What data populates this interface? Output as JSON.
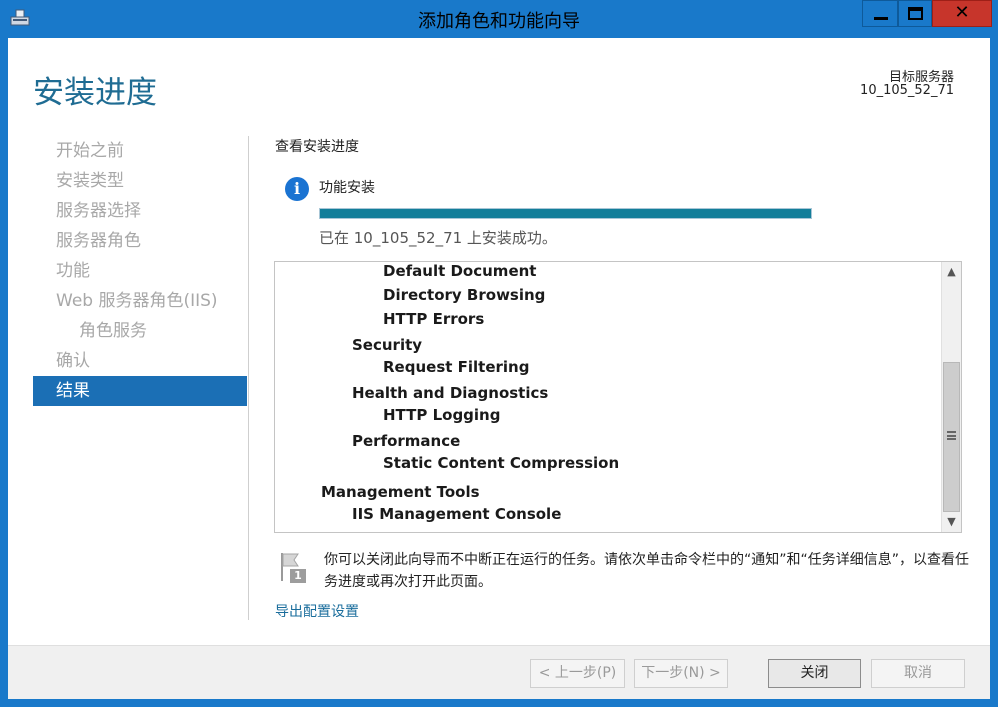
{
  "window": {
    "title": "添加角色和功能向导"
  },
  "header": {
    "page_title": "安装进度",
    "target_label": "目标服务器",
    "target_name": "10_105_52_71"
  },
  "nav": {
    "items": [
      {
        "label": "开始之前"
      },
      {
        "label": "安装类型"
      },
      {
        "label": "服务器选择"
      },
      {
        "label": "服务器角色"
      },
      {
        "label": "功能"
      },
      {
        "label": "Web 服务器角色(IIS)"
      },
      {
        "label": "角色服务"
      },
      {
        "label": "确认"
      },
      {
        "label": "结果"
      }
    ],
    "active_index": 8
  },
  "main": {
    "section_heading": "查看安装进度",
    "feature_label": "功能安装",
    "progress_percent": 100,
    "status_text": "已在 10_105_52_71 上安装成功。",
    "results": [
      {
        "label": "Default Document",
        "level": 3
      },
      {
        "label": "Directory Browsing",
        "level": 3
      },
      {
        "label": "HTTP Errors",
        "level": 3
      },
      {
        "label": "Security",
        "level": 2
      },
      {
        "label": "Request Filtering",
        "level": 3
      },
      {
        "label": "Health and Diagnostics",
        "level": 2
      },
      {
        "label": "HTTP Logging",
        "level": 3
      },
      {
        "label": "Performance",
        "level": 2
      },
      {
        "label": "Static Content Compression",
        "level": 3
      },
      {
        "label": "Management Tools",
        "level": 1
      },
      {
        "label": "IIS Management Console",
        "level": 2
      }
    ],
    "notice_badge": "1",
    "notice_text": "你可以关闭此向导而不中断正在运行的任务。请依次单击命令栏中的“通知”和“任务详细信息”，以查看任务进度或再次打开此页面。",
    "export_link": "导出配置设置"
  },
  "footer": {
    "prev_label": "< 上一步(P)",
    "next_label": "下一步(N) >",
    "close_label": "关闭",
    "cancel_label": "取消"
  },
  "colors": {
    "titlebar": "#1979ca",
    "title_accent": "#1f6c93",
    "nav_active": "#1b6fb5",
    "progress": "#137e9a",
    "link": "#1a6d9c",
    "close_button": "#c7352b"
  }
}
